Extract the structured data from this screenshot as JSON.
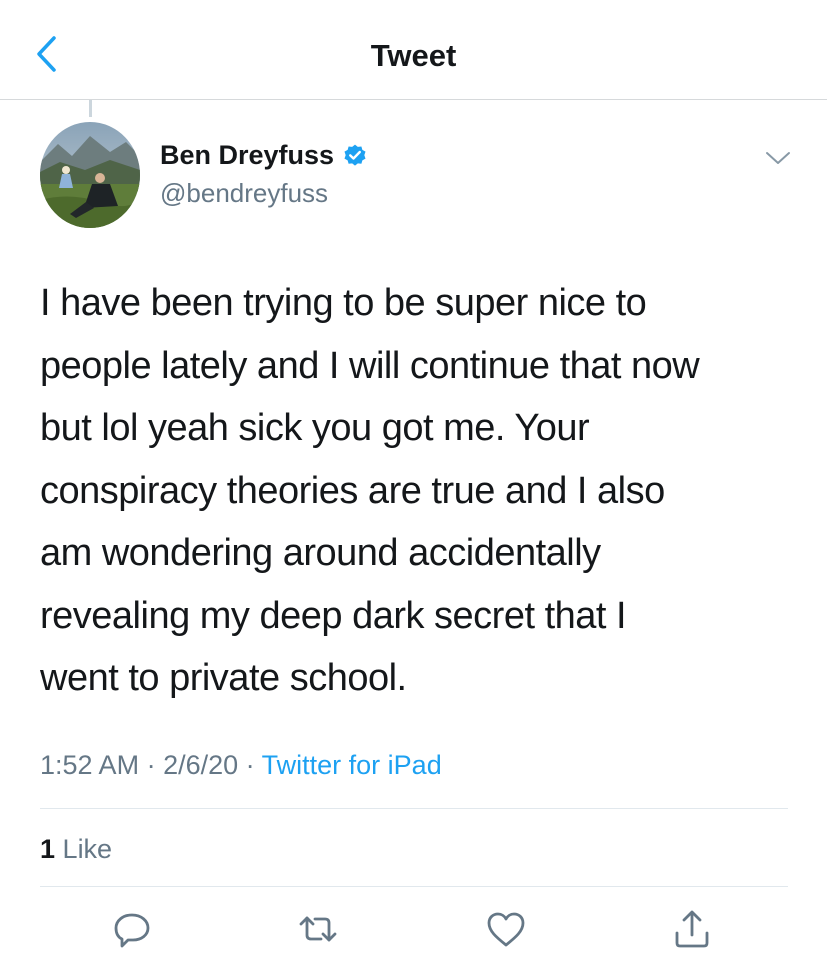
{
  "header": {
    "title": "Tweet"
  },
  "author": {
    "name": "Ben Dreyfuss",
    "handle": "@bendreyfuss"
  },
  "tweet": {
    "lines": [
      "I have been trying to be super nice to",
      "people lately and I will continue that now",
      "but lol yeah sick you got me. Your",
      "conspiracy theories are true and I also",
      "am wondering around accidentally",
      "revealing my deep dark secret that I",
      "went to private school."
    ],
    "time": "1:52 AM",
    "date": "2/6/20",
    "separator": " · ",
    "source": "Twitter for iPad"
  },
  "stats": {
    "likes_count": "1",
    "likes_label": "Like"
  },
  "colors": {
    "accent": "#1da1f2",
    "text": "#14171a",
    "secondary": "#657786",
    "divider": "#e1e8ed"
  },
  "icons": {
    "back": "chevron-left-icon",
    "verified": "verified-badge-icon",
    "more": "chevron-down-icon",
    "reply": "reply-icon",
    "retweet": "retweet-icon",
    "like": "heart-icon",
    "share": "share-icon"
  }
}
